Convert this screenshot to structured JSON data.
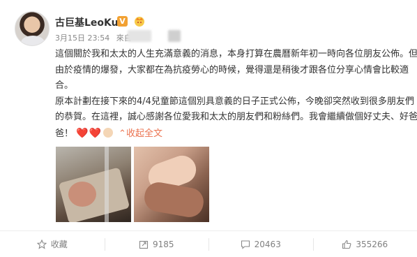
{
  "post": {
    "author": "古巨基LeoKu",
    "badge": "V",
    "date": "3月15日 23:54",
    "source_prefix": "來自",
    "paragraphs": [
      "這個關於我和太太的人生充滿意義的消息，本身打算在農曆新年初一時向各位朋友公佈。但由於疫情的爆發，大家都在為抗疫勞心的時候，覺得還是稍後才跟各位分享心情會比較適合。",
      "原本計劃在接下來的4/4兒童節這個別具意義的日子正式公佈，今晚卻突然收到很多朋友們的恭賀。在這裡，誠心感謝各位愛我和太太的朋友們和粉絲們。我會繼續做個好丈夫、好爸爸！"
    ],
    "hearts": "❤️❤️",
    "expand_label": "收起全文"
  },
  "actions": {
    "favorite_label": "收藏",
    "repost_count": "9185",
    "comment_count": "20463",
    "like_count": "355266"
  },
  "colors": {
    "accent": "#eb7350",
    "badge": "#f2a132",
    "heart": "#e5343d"
  }
}
